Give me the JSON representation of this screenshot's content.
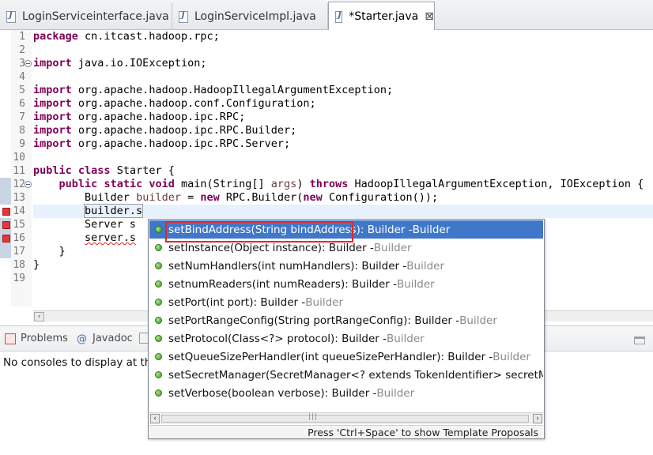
{
  "tabs": [
    {
      "label": "LoginServiceinterface.java",
      "active": false
    },
    {
      "label": "LoginServiceImpl.java",
      "active": false
    },
    {
      "label": "*Starter.java",
      "active": true,
      "close_glyph": "⊠"
    }
  ],
  "editor": {
    "line_numbers": [
      "1",
      "2",
      "3",
      "4",
      "5",
      "6",
      "7",
      "8",
      "9",
      "10",
      "11",
      "12",
      "13",
      "14",
      "15",
      "16",
      "17",
      "18",
      "19"
    ],
    "lines": {
      "l1": {
        "kw": "package",
        "rest": " cn.itcast.hadoop.rpc;"
      },
      "l3": {
        "kw": "import",
        "rest": " java.io.IOException;"
      },
      "l5": {
        "kw": "import",
        "rest": " org.apache.hadoop.HadoopIllegalArgumentException;"
      },
      "l6": {
        "kw": "import",
        "rest": " org.apache.hadoop.conf.Configuration;"
      },
      "l7": {
        "kw": "import",
        "rest": " org.apache.hadoop.ipc.RPC;"
      },
      "l8": {
        "kw": "import",
        "rest": " org.apache.hadoop.ipc.RPC.Builder;"
      },
      "l9": {
        "kw": "import",
        "rest": " org.apache.hadoop.ipc.RPC.Server;"
      },
      "l11": {
        "kw1": "public",
        "kw2": "class",
        "rest": " Starter {"
      },
      "l12": {
        "indent": "    ",
        "kw1": "public",
        "kw2": "static",
        "kw3": "void",
        "mid": " main(String[] ",
        "param": "args",
        "mid2": ") ",
        "kw4": "throws",
        "rest": " HadoopIllegalArgumentException, IOException {"
      },
      "l13": {
        "indent": "        ",
        "pre": "Builder ",
        "param": "builder",
        "mid": " = ",
        "kw1": "new",
        "mid2": " RPC.Builder(",
        "kw2": "new",
        "rest": " Configuration());"
      },
      "l14": {
        "indent": "        ",
        "text": "builder.s"
      },
      "l15": {
        "indent": "        ",
        "text": "Server s"
      },
      "l16": {
        "indent": "        ",
        "text": "server.s"
      },
      "l17": {
        "text": "    }"
      },
      "l18": {
        "text": "}"
      }
    }
  },
  "bottom_views": {
    "tabs": [
      {
        "label": "Problems",
        "icon": "problems-icon"
      },
      {
        "label": "Javadoc",
        "icon": "javadoc-icon",
        "glyph": "@"
      },
      {
        "label": "",
        "icon": "declaration-icon"
      }
    ],
    "console_message": "No consoles to display at thi"
  },
  "assist": {
    "items": [
      {
        "method": "setBindAddress(String bindAddress)",
        "ret": " : Builder - ",
        "owner": "Builder",
        "selected": true
      },
      {
        "method": "setInstance(Object instance)",
        "ret": " : Builder - ",
        "owner": "Builder",
        "selected": false
      },
      {
        "method": "setNumHandlers(int numHandlers)",
        "ret": " : Builder - ",
        "owner": "Builder",
        "selected": false
      },
      {
        "method": "setnumReaders(int numReaders)",
        "ret": " : Builder - ",
        "owner": "Builder",
        "selected": false
      },
      {
        "method": "setPort(int port)",
        "ret": " : Builder - ",
        "owner": "Builder",
        "selected": false
      },
      {
        "method": "setPortRangeConfig(String portRangeConfig)",
        "ret": " : Builder - ",
        "owner": "Builder",
        "selected": false
      },
      {
        "method": "setProtocol(Class<?> protocol)",
        "ret": " : Builder - ",
        "owner": "Builder",
        "selected": false
      },
      {
        "method": "setQueueSizePerHandler(int queueSizePerHandler)",
        "ret": " : Builder - ",
        "owner": "Builder",
        "selected": false
      },
      {
        "method": "setSecretManager(SecretManager<? extends TokenIdentifier> secretMar",
        "ret": "",
        "owner": "",
        "selected": false
      },
      {
        "method": "setVerbose(boolean verbose)",
        "ret": " : Builder - ",
        "owner": "Builder",
        "selected": false
      }
    ],
    "footer": "Press 'Ctrl+Space' to show Template Proposals",
    "scroll_left": "‹",
    "scroll_right": "›"
  },
  "colors": {
    "keyword": "#7f0055",
    "selection": "#3f77c9",
    "highlight_box": "#e02a2a"
  }
}
